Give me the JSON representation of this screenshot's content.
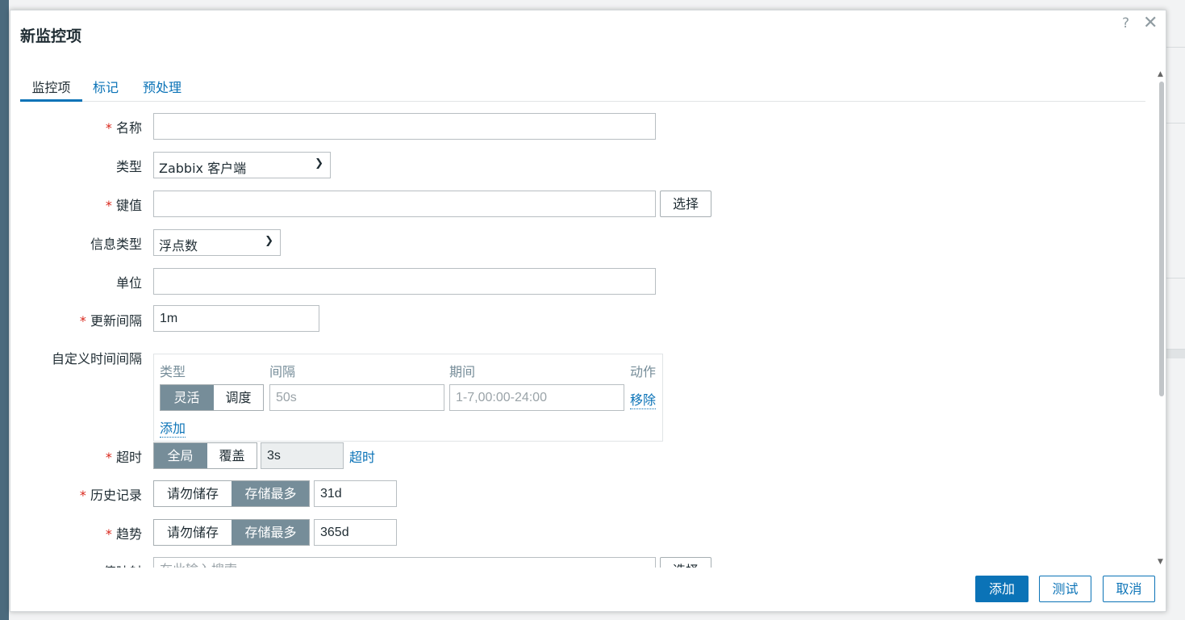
{
  "dialog": {
    "title": "新监控项",
    "help_icon": "?",
    "close_icon": "✕"
  },
  "tabs": [
    {
      "label": "监控项",
      "active": true
    },
    {
      "label": "标记",
      "active": false
    },
    {
      "label": "预处理",
      "active": false
    }
  ],
  "form": {
    "name": {
      "label": "名称",
      "required": true,
      "value": ""
    },
    "type": {
      "label": "类型",
      "value": "Zabbix 客户端"
    },
    "key": {
      "label": "键值",
      "required": true,
      "value": "",
      "select_label": "选择"
    },
    "info_type": {
      "label": "信息类型",
      "value": "浮点数"
    },
    "units": {
      "label": "单位",
      "value": ""
    },
    "update_interval": {
      "label": "更新间隔",
      "required": true,
      "value": "1m"
    },
    "custom_intervals": {
      "label": "自定义时间间隔",
      "headers": {
        "type": "类型",
        "interval": "间隔",
        "period": "期间",
        "action": "动作"
      },
      "rows": [
        {
          "type_options": [
            "灵活",
            "调度"
          ],
          "type_selected": "灵活",
          "interval_placeholder": "50s",
          "period_placeholder": "1-7,00:00-24:00",
          "remove_label": "移除"
        }
      ],
      "add_label": "添加"
    },
    "timeout": {
      "label": "超时",
      "required": true,
      "options": [
        "全局",
        "覆盖"
      ],
      "selected": "全局",
      "value": "3s",
      "link_label": "超时"
    },
    "history": {
      "label": "历史记录",
      "required": true,
      "options": [
        "请勿储存",
        "存储最多"
      ],
      "selected": "存储最多",
      "value": "31d"
    },
    "trends": {
      "label": "趋势",
      "required": true,
      "options": [
        "请勿储存",
        "存储最多"
      ],
      "selected": "存储最多",
      "value": "365d"
    },
    "value_map": {
      "label": "值映射",
      "placeholder": "在此输入搜索",
      "select_label": "选择"
    }
  },
  "footer": {
    "add_label": "添加",
    "test_label": "测试",
    "cancel_label": "取消"
  },
  "colors": {
    "accent": "#0b73b7",
    "segment_active": "#768d99",
    "required": "#d9271c"
  }
}
